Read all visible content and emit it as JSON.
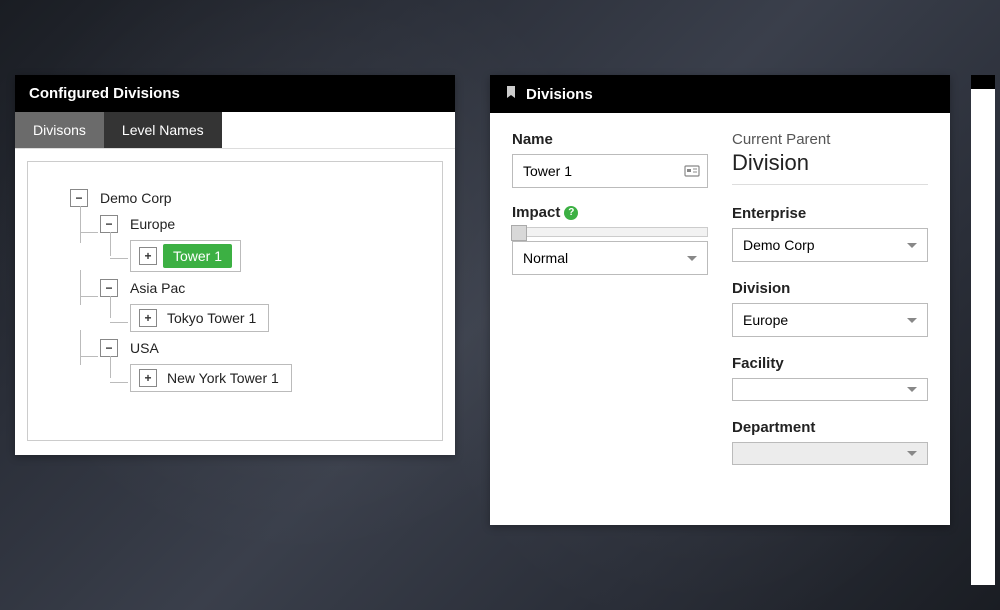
{
  "left": {
    "title": "Configured Divisions",
    "tabs": {
      "active": "Divisons",
      "inactive": "Level Names"
    },
    "tree": {
      "root": "Demo Corp",
      "europe": "Europe",
      "tower1": "Tower 1",
      "asiapac": "Asia Pac",
      "tokyo": "Tokyo Tower 1",
      "usa": "USA",
      "ny": "New York Tower 1"
    }
  },
  "right": {
    "title": "Divisions",
    "labels": {
      "name": "Name",
      "impact": "Impact",
      "current_parent": "Current Parent",
      "enterprise": "Enterprise",
      "division": "Division",
      "facility": "Facility",
      "department": "Department"
    },
    "values": {
      "name": "Tower 1",
      "impact": "Normal",
      "parent": "Division",
      "enterprise": "Demo Corp",
      "division": "Europe",
      "facility": "",
      "department": ""
    }
  },
  "glyphs": {
    "plus": "+",
    "minus": "−",
    "help": "?"
  }
}
